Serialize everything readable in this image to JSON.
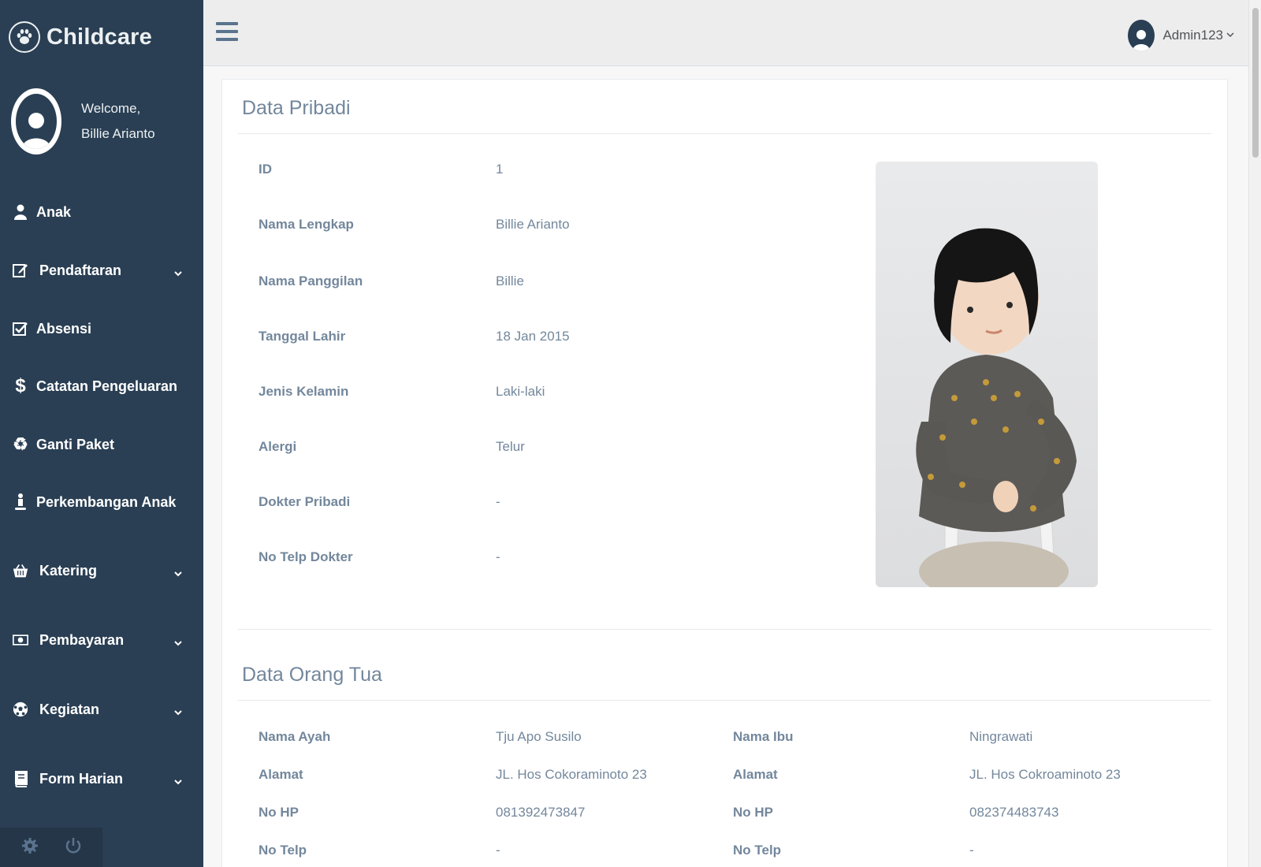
{
  "brand": {
    "name": "Childcare",
    "icon": "paw-icon"
  },
  "profile": {
    "welcome": "Welcome,",
    "name": "Billie Arianto"
  },
  "sidebar": {
    "items": [
      {
        "label": "Anak",
        "icon": "user-icon",
        "has_submenu": false
      },
      {
        "label": "Pendaftaran",
        "icon": "edit-icon",
        "has_submenu": true
      },
      {
        "label": "Absensi",
        "icon": "checkbox-icon",
        "has_submenu": false
      },
      {
        "label": "Catatan Pengeluaran",
        "icon": "dollar-icon",
        "has_submenu": false
      },
      {
        "label": "Ganti Paket",
        "icon": "recycle-icon",
        "has_submenu": false
      },
      {
        "label": "Perkembangan Anak",
        "icon": "child-icon",
        "has_submenu": false
      },
      {
        "label": "Katering",
        "icon": "basket-icon",
        "has_submenu": true
      },
      {
        "label": "Pembayaran",
        "icon": "money-icon",
        "has_submenu": true
      },
      {
        "label": "Kegiatan",
        "icon": "soccer-ball-icon",
        "has_submenu": true
      },
      {
        "label": "Form Harian",
        "icon": "book-icon",
        "has_submenu": true
      }
    ],
    "footer": {
      "settings_icon": "gear-icon",
      "logout_icon": "power-icon"
    }
  },
  "topnav": {
    "user": "Admin123"
  },
  "data_pribadi": {
    "title": "Data Pribadi",
    "fields": [
      {
        "label": "ID",
        "value": "1"
      },
      {
        "label": "Nama Lengkap",
        "value": "Billie Arianto"
      },
      {
        "label": "Nama Panggilan",
        "value": "Billie"
      },
      {
        "label": "Tanggal Lahir",
        "value": "18 Jan 2015"
      },
      {
        "label": "Jenis Kelamin",
        "value": "Laki-laki"
      },
      {
        "label": "Alergi",
        "value": "Telur"
      },
      {
        "label": "Dokter Pribadi",
        "value": "-"
      },
      {
        "label": "No Telp Dokter",
        "value": "-"
      }
    ]
  },
  "data_orang_tua": {
    "title": "Data Orang Tua",
    "ayah": [
      {
        "label": "Nama Ayah",
        "value": "Tju Apo Susilo"
      },
      {
        "label": "Alamat",
        "value": "JL. Hos Cokoraminoto 23"
      },
      {
        "label": "No HP",
        "value": "081392473847"
      },
      {
        "label": "No Telp",
        "value": "-"
      }
    ],
    "ibu": [
      {
        "label": "Nama Ibu",
        "value": "Ningrawati"
      },
      {
        "label": "Alamat",
        "value": "JL. Hos Cokroaminoto 23"
      },
      {
        "label": "No HP",
        "value": "082374483743"
      },
      {
        "label": "No Telp",
        "value": "-"
      }
    ]
  },
  "colors": {
    "sidebar": "#2a3f54",
    "text": "#73879c",
    "topnav": "#ededed"
  }
}
